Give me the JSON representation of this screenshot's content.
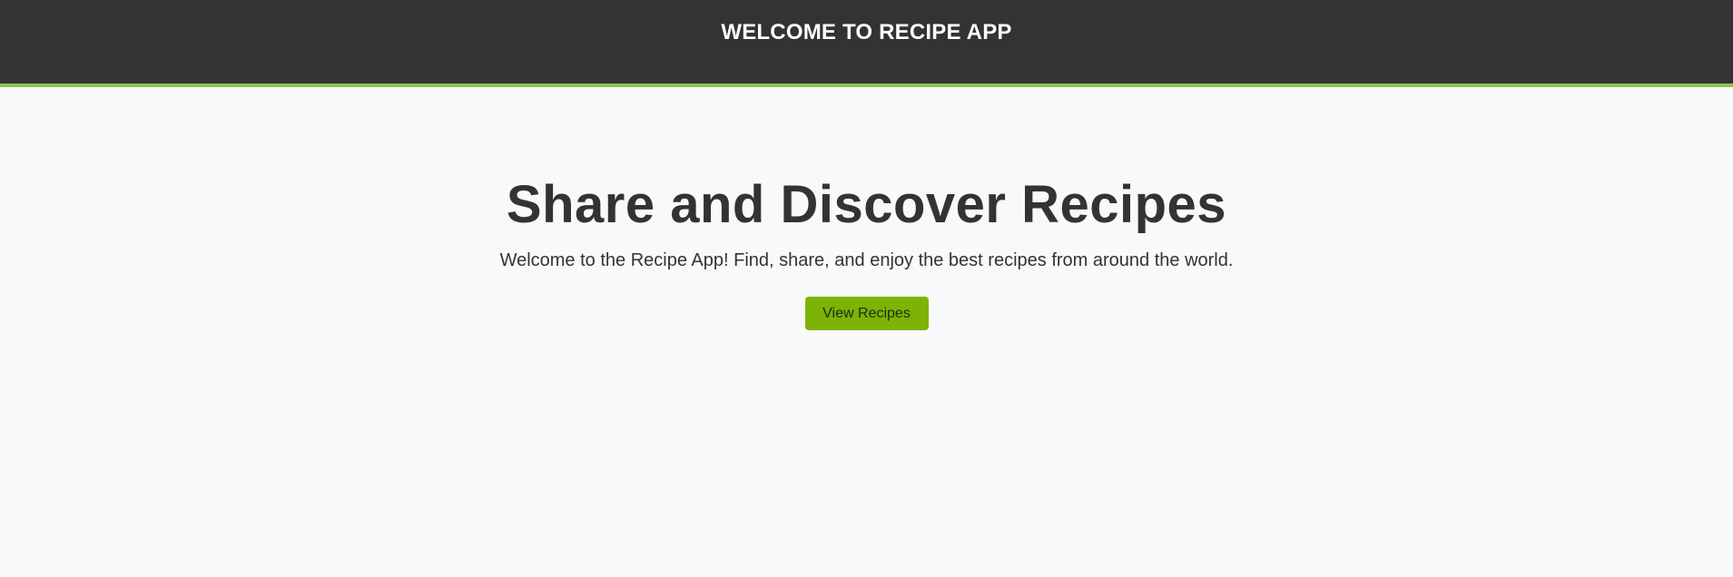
{
  "header": {
    "title": "WELCOME TO RECIPE APP"
  },
  "hero": {
    "title": "Share and Discover Recipes",
    "subtitle": "Welcome to the Recipe App! Find, share, and enjoy the best recipes from around the world.",
    "button_label": "View Recipes"
  },
  "colors": {
    "header_bg": "#333333",
    "accent": "#8bc34a",
    "button_bg": "#7cb305",
    "page_bg": "#f8f9fa",
    "text": "#333333"
  }
}
